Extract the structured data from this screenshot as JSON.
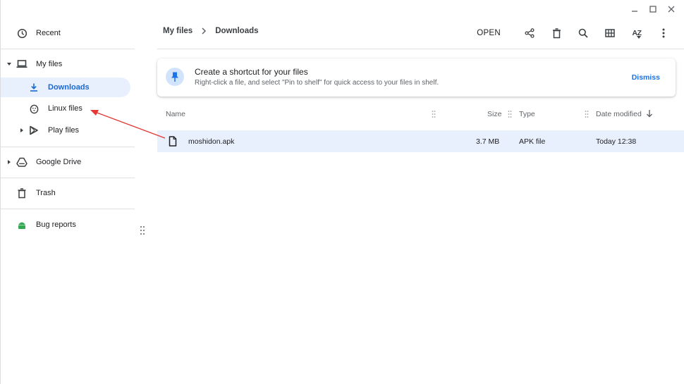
{
  "window": {
    "controls": [
      "minimize",
      "maximize",
      "close"
    ]
  },
  "sidebar": {
    "items": [
      {
        "label": "Recent",
        "icon": "clock-icon"
      },
      {
        "label": "My files",
        "icon": "laptop-icon",
        "expanded": true
      },
      {
        "label": "Downloads",
        "icon": "download-icon",
        "selected": true
      },
      {
        "label": "Linux files",
        "icon": "penguin-icon"
      },
      {
        "label": "Play files",
        "icon": "play-store-icon"
      },
      {
        "label": "Google Drive",
        "icon": "drive-icon"
      },
      {
        "label": "Trash",
        "icon": "trash-icon"
      },
      {
        "label": "Bug reports",
        "icon": "android-icon"
      }
    ]
  },
  "header": {
    "breadcrumb": [
      "My files",
      "Downloads"
    ],
    "open_label": "OPEN",
    "sort_label": "AZ"
  },
  "banner": {
    "title": "Create a shortcut for your files",
    "subtitle": "Right-click a file, and select \"Pin to shelf\" for quick access to your files in shelf.",
    "dismiss": "Dismiss"
  },
  "table": {
    "columns": [
      "Name",
      "Size",
      "Type",
      "Date modified"
    ],
    "sort": {
      "column": "Date modified",
      "direction": "descending"
    },
    "rows": [
      {
        "name": "moshidon.apk",
        "size": "3.7 MB",
        "type": "APK file",
        "date": "Today 12:38"
      }
    ]
  },
  "colors": {
    "accent": "#1a73e8",
    "selection": "#e8f0fe",
    "annotation_arrow": "#e53935"
  }
}
